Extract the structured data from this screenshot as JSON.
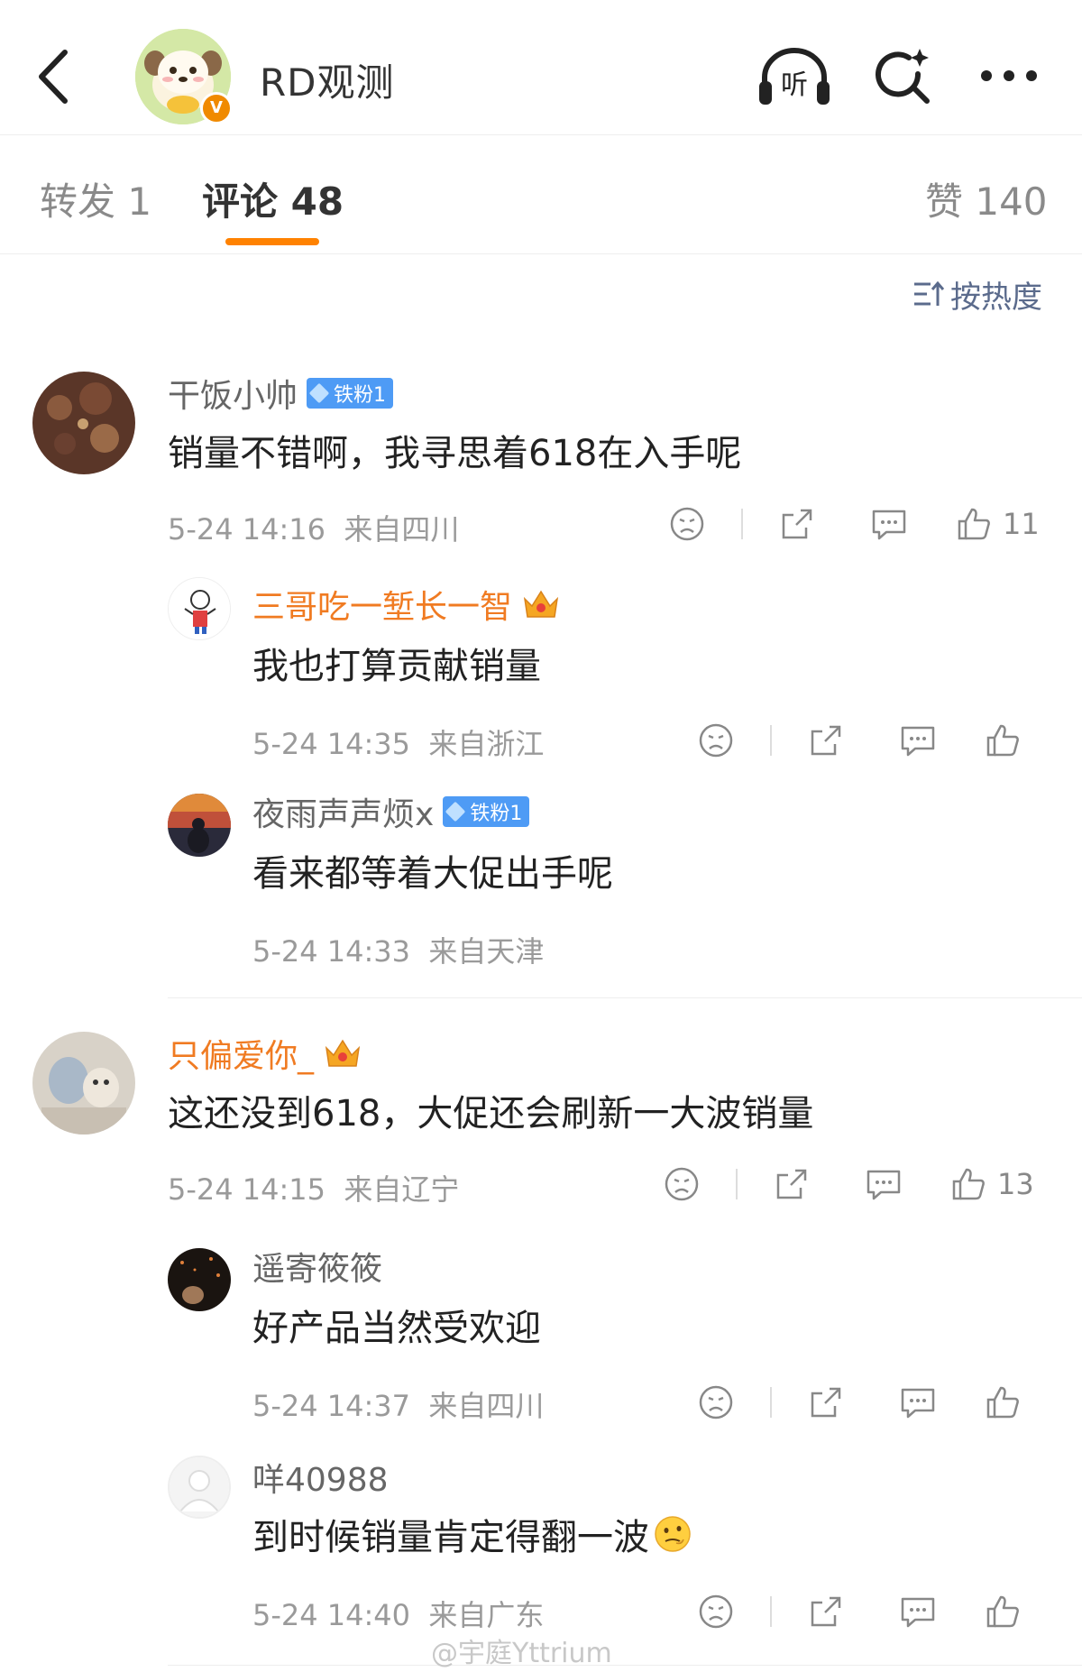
{
  "header": {
    "title": "RD观测",
    "verified_mark": "V",
    "listen_label": "听"
  },
  "tabs": [
    {
      "label": "转发 1"
    },
    {
      "label": "评论 48"
    },
    {
      "label": "赞 140"
    }
  ],
  "sort_label": "按热度",
  "colors": {
    "accent": "#ff8200",
    "vip_name": "#f07b22",
    "fan_badge": "#4e9bf5"
  },
  "comments": [
    {
      "user": "干饭小帅",
      "badge": "铁粉1",
      "text": "销量不错啊，我寻思着618在入手呢",
      "time": "5-24 14:16",
      "location": "来自四川",
      "likes": "11",
      "replies": [
        {
          "user": "三哥吃一堑长一智",
          "badge_icon": "crown-icon",
          "text": "我也打算贡献销量",
          "time": "5-24 14:35",
          "location": "来自浙江"
        },
        {
          "user": "夜雨声声烦x",
          "badge": "铁粉1",
          "text": "看来都等着大促出手呢",
          "time": "5-24 14:33",
          "location": "来自天津"
        }
      ]
    },
    {
      "user": "只偏爱你_",
      "badge_icon": "crown-icon",
      "text": "这还没到618，大促还会刷新一大波销量",
      "time": "5-24 14:15",
      "location": "来自辽宁",
      "likes": "13",
      "replies": [
        {
          "user": "遥寄筱筱",
          "text": "好产品当然受欢迎",
          "time": "5-24 14:37",
          "location": "来自四川"
        },
        {
          "user": "咩40988",
          "text": "到时候销量肯定得翻一波",
          "emoji": "thinking-emoji",
          "time": "5-24 14:40",
          "location": "来自广东"
        }
      ]
    }
  ],
  "watermark": "@宇庭Yttrium"
}
